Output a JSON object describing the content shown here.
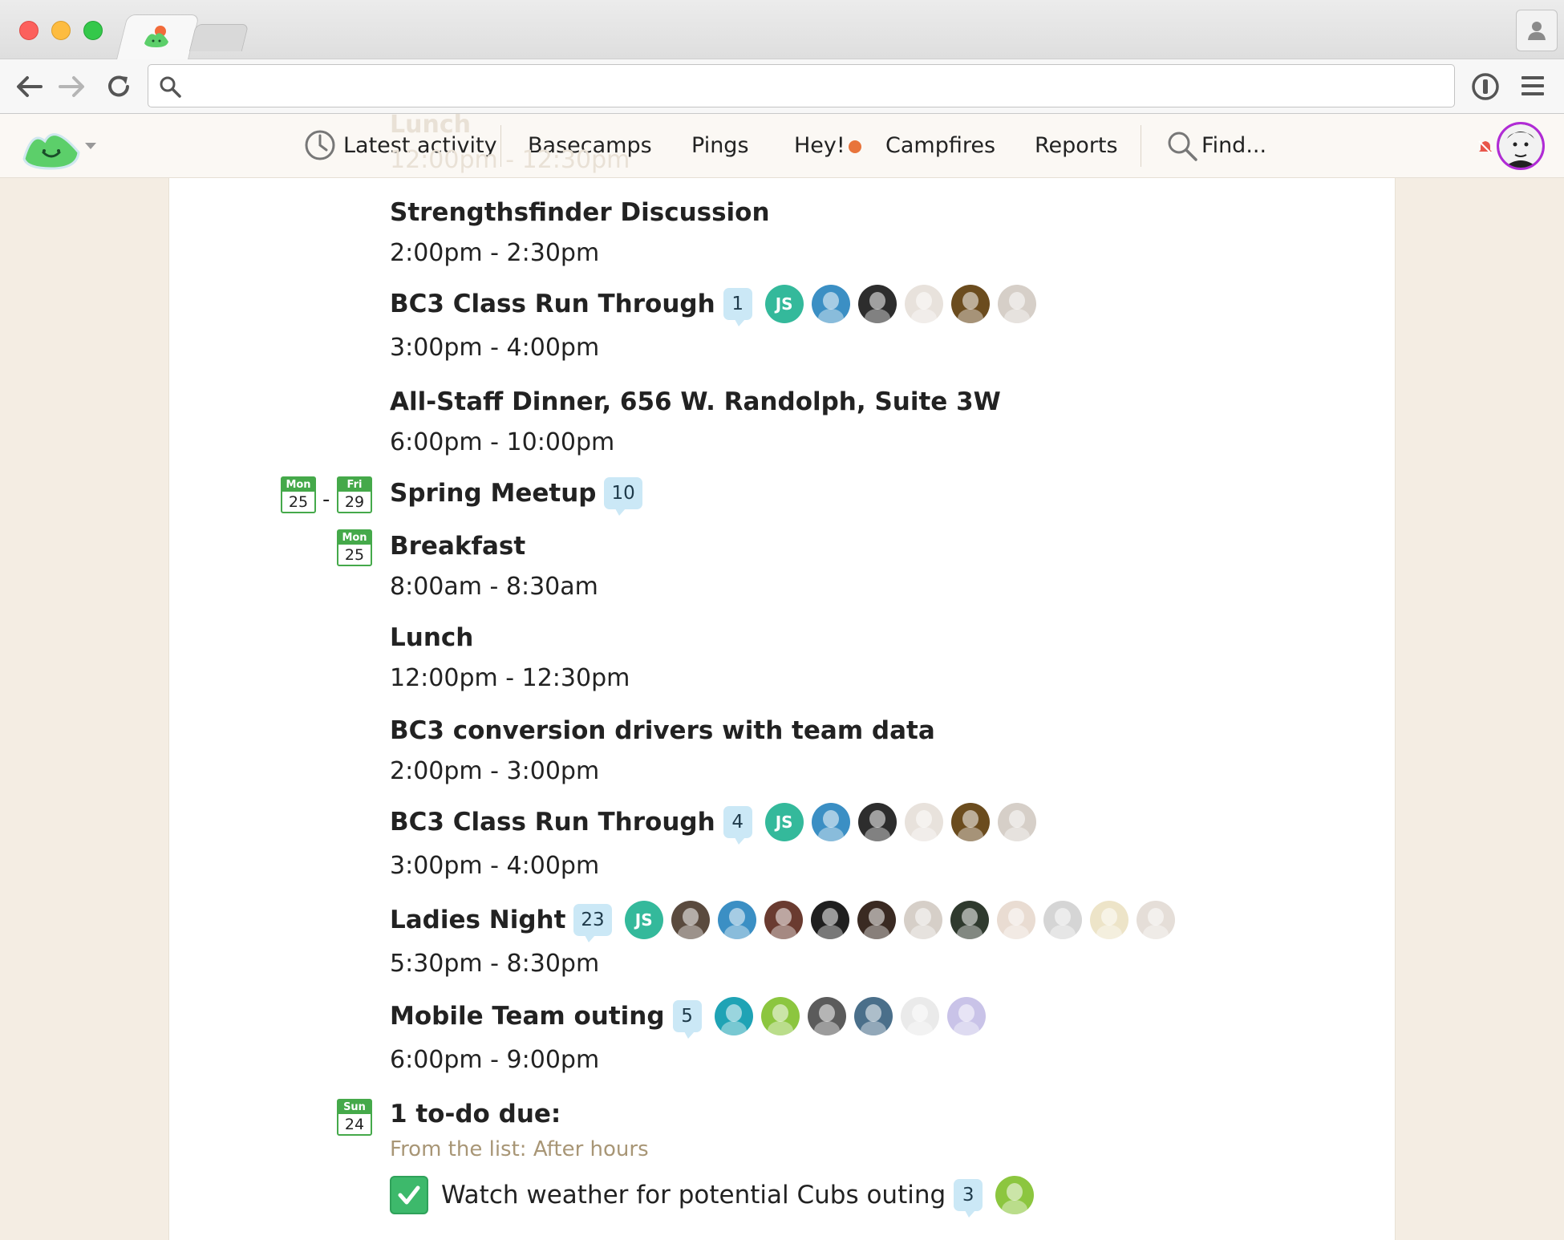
{
  "browser": {
    "address_placeholder": "",
    "address_value": ""
  },
  "nav": {
    "latest_activity": "Latest activity",
    "basecamps": "Basecamps",
    "pings": "Pings",
    "hey": "Hey!",
    "campfires": "Campfires",
    "reports": "Reports",
    "find": "Find..."
  },
  "faded_header": {
    "title": "Lunch",
    "time": "12:00pm - 12:30pm"
  },
  "events": [
    {
      "title": "Strengthsfinder Discussion",
      "time": "2:00pm - 2:30pm"
    },
    {
      "title": "BC3 Class Run Through",
      "comments": "1",
      "time": "3:00pm - 4:00pm",
      "initials": "JS"
    },
    {
      "title": "All-Staff Dinner, 656 W. Randolph, Suite 3W",
      "time": "6:00pm - 10:00pm"
    },
    {
      "title": "Spring Meetup",
      "comments": "10"
    },
    {
      "title": "Breakfast",
      "time": "8:00am - 8:30am"
    },
    {
      "title": "Lunch",
      "time": "12:00pm - 12:30pm"
    },
    {
      "title": "BC3 conversion drivers with team data",
      "time": "2:00pm - 3:00pm"
    },
    {
      "title": "BC3 Class Run Through",
      "comments": "4",
      "time": "3:00pm - 4:00pm",
      "initials": "JS"
    },
    {
      "title": "Ladies Night",
      "comments": "23",
      "time": "5:30pm - 8:30pm",
      "initials": "JS"
    },
    {
      "title": "Mobile Team outing",
      "comments": "5",
      "time": "6:00pm - 9:00pm"
    },
    {
      "title": "1 to-do due:"
    }
  ],
  "calendar": {
    "range_start": {
      "dow": "Mon",
      "day": "25"
    },
    "range_dash": "-",
    "range_end": {
      "dow": "Fri",
      "day": "29"
    },
    "day1": {
      "dow": "Mon",
      "day": "25"
    },
    "day2": {
      "dow": "Sun",
      "day": "24"
    }
  },
  "todo": {
    "list_label": "From the list: After hours",
    "text": "Watch weather for potential Cubs outing",
    "comments": "3"
  },
  "colors": {
    "accent_green": "#45a94a",
    "bubble_blue": "#cbe8f6",
    "hey_dot": "#e8743b",
    "js_avatar": "#34b99b",
    "page_bg": "#f4ede3"
  }
}
